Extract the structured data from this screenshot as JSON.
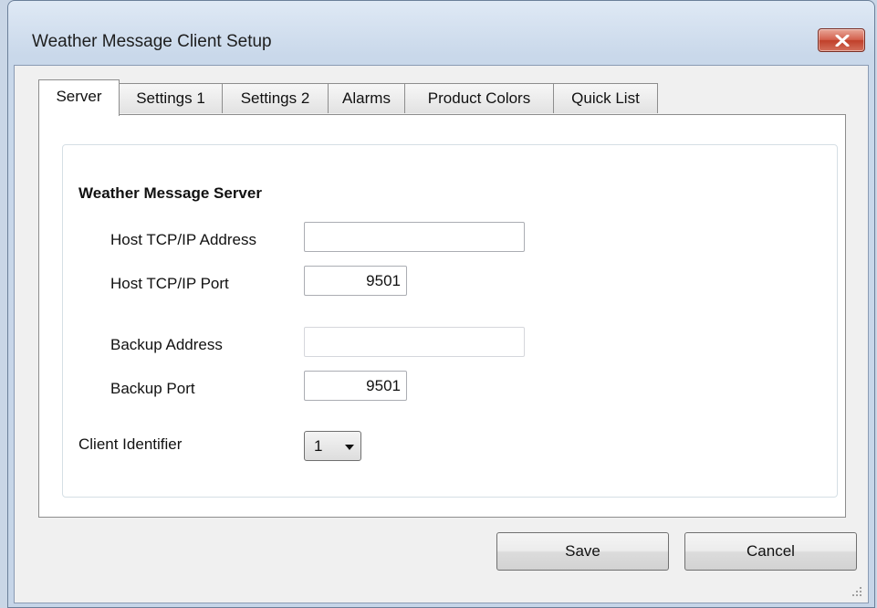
{
  "window": {
    "title": "Weather Message Client Setup"
  },
  "tabs": [
    {
      "label": "Server",
      "active": true
    },
    {
      "label": "Settings 1"
    },
    {
      "label": "Settings 2"
    },
    {
      "label": "Alarms"
    },
    {
      "label": "Product Colors"
    },
    {
      "label": "Quick List"
    }
  ],
  "server": {
    "group_title": "Weather Message Server",
    "host_address_label": "Host TCP/IP Address",
    "host_address_value": "",
    "host_port_label": "Host TCP/IP Port",
    "host_port_value": "9501",
    "backup_address_label": "Backup Address",
    "backup_address_value": "",
    "backup_port_label": "Backup Port",
    "backup_port_value": "9501",
    "client_identifier_label": "Client Identifier",
    "client_identifier_value": "1"
  },
  "buttons": {
    "save": "Save",
    "cancel": "Cancel"
  },
  "icons": {
    "close": "close-icon",
    "dropdown": "chevron-down-icon",
    "resize": "resize-grip-icon"
  },
  "colors": {
    "close_button": "#c9452f",
    "title_bar": "#c9d8ea",
    "client_bg": "#f0f0f0"
  }
}
